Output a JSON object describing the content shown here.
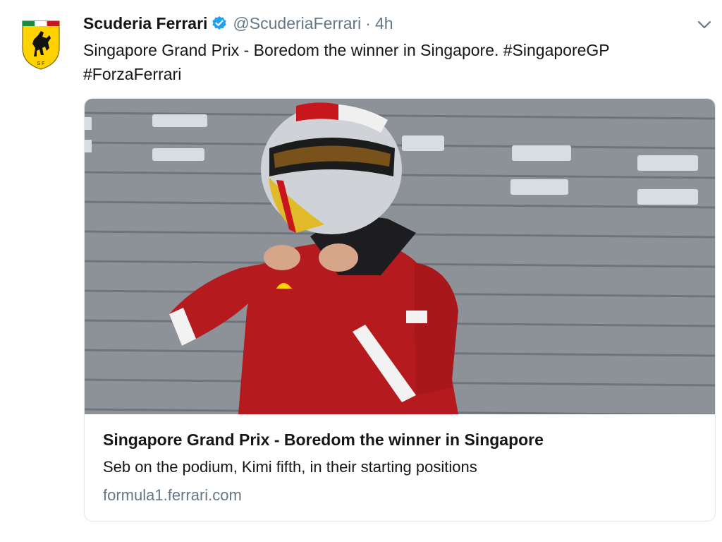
{
  "tweet": {
    "author_name": "Scuderia Ferrari",
    "handle": "@ScuderiaFerrari",
    "separator": "·",
    "time": "4h",
    "text": "Singapore Grand Prix - Boredom the winner in Singapore. #SingaporeGP #ForzaFerrari",
    "avatar_icon": "ferrari-shield-logo",
    "verified_icon": "verified-badge-icon",
    "menu_icon": "chevron-down-icon"
  },
  "card": {
    "title": "Singapore Grand Prix - Boredom the winner in Singapore",
    "description": "Seb on the podium, Kimi fifth, in their starting positions",
    "domain": "formula1.ferrari.com",
    "image_subject": "driver in red race suit fastening helmet"
  },
  "colors": {
    "text": "#14171a",
    "muted": "#657786",
    "verified_blue": "#1da1f2",
    "ferrari_yellow": "#ffd200",
    "ferrari_red": "#c8161d",
    "border": "#e1e8ed"
  }
}
